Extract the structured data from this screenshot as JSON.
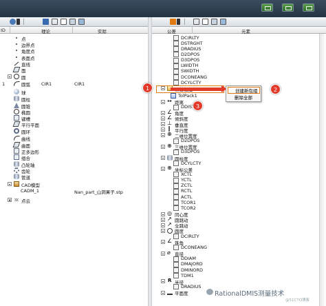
{
  "left_pane": {
    "columns": {
      "id": "ID",
      "nominal": "理论",
      "actual": "实际"
    },
    "features": [
      {
        "label": "点",
        "icon": "point-icon"
      },
      {
        "label": "边界点",
        "icon": "edge-point-icon"
      },
      {
        "label": "角度点",
        "icon": "angle-point-icon"
      },
      {
        "label": "表面点",
        "icon": "surface-point-icon"
      },
      {
        "label": "直线",
        "icon": "line-icon"
      },
      {
        "label": "面",
        "icon": "plane-icon"
      },
      {
        "label": "圆",
        "icon": "circle-icon"
      },
      {
        "label": "圆弧",
        "icon": "arc-icon"
      },
      {
        "label": "球",
        "icon": "sphere-icon"
      },
      {
        "label": "圆柱",
        "icon": "cylinder-icon"
      },
      {
        "label": "圆锥",
        "icon": "cone-icon"
      },
      {
        "label": "椭圆",
        "icon": "ellipse-icon"
      },
      {
        "label": "键槽",
        "icon": "slot-icon"
      },
      {
        "label": "平行平面",
        "icon": "parallel-planes-icon"
      },
      {
        "label": "圆环",
        "icon": "torus-icon"
      },
      {
        "label": "曲线",
        "icon": "curve-icon"
      },
      {
        "label": "曲面",
        "icon": "surface-icon"
      },
      {
        "label": "正多边形",
        "icon": "polygon-icon"
      },
      {
        "label": "组合",
        "icon": "compound-icon"
      },
      {
        "label": "凸轮轴",
        "icon": "camshaft-icon"
      },
      {
        "label": "齿轮",
        "icon": "gear-icon"
      },
      {
        "label": "管道",
        "icon": "pipe-icon"
      },
      {
        "label": "CAD模型",
        "icon": "cad-model-icon"
      },
      {
        "label": "点云",
        "icon": "point-cloud-icon"
      }
    ],
    "circle_item": {
      "id": "1",
      "nominal": "CIR1",
      "actual": "CIR1"
    },
    "cad_item": {
      "name": "CADM_1",
      "file": "Nan_part_山洞果子.stp"
    }
  },
  "right_pane": {
    "columns": {
      "tolerance": "公差",
      "element": "元素"
    },
    "rows": [
      {
        "label": "DCIRLTY",
        "icon": "tolerance-icon"
      },
      {
        "label": "DSTRGHT",
        "icon": "tolerance-icon"
      },
      {
        "label": "DRADIUS",
        "icon": "tolerance-icon"
      },
      {
        "label": "D2DPOS",
        "icon": "tolerance-icon"
      },
      {
        "label": "D3DPOS",
        "icon": "tolerance-icon"
      },
      {
        "label": "LWIDTH",
        "icon": "tolerance-icon"
      },
      {
        "label": "SWIDTH",
        "icon": "tolerance-icon"
      },
      {
        "label": "DCONEANG",
        "icon": "tolerance-icon"
      },
      {
        "label": "DCYLCTY",
        "icon": "tolerance-icon"
      },
      {
        "label": "公差包组",
        "icon": "tolerance-group-icon"
      },
      {
        "label": "TolPack1",
        "icon": "tolerance-pack-icon"
      },
      {
        "label": "距离",
        "icon": "distance-icon"
      },
      {
        "label": "DDIST",
        "icon": "tolerance-icon"
      },
      {
        "label": "角度",
        "icon": "angle-icon"
      },
      {
        "label": "倾斜度",
        "icon": "angularity-icon"
      },
      {
        "label": "垂直度",
        "icon": "perpendicularity-icon"
      },
      {
        "label": "平行度",
        "icon": "parallelism-icon"
      },
      {
        "label": "二维位置度",
        "icon": "position-2d-icon"
      },
      {
        "label": "D2DPOS",
        "icon": "tolerance-icon"
      },
      {
        "label": "三维位置度",
        "icon": "position-3d-icon"
      },
      {
        "label": "D3DPOS",
        "icon": "tolerance-icon"
      },
      {
        "label": "圆柱度",
        "icon": "cylindricity-icon"
      },
      {
        "label": "DCYLCTY",
        "icon": "tolerance-icon"
      },
      {
        "label": "坐标公差",
        "icon": "coordinate-tolerance-icon"
      },
      {
        "label": "XCTL",
        "icon": "tolerance-icon"
      },
      {
        "label": "YCTL",
        "icon": "tolerance-icon"
      },
      {
        "label": "ZCTL",
        "icon": "tolerance-icon"
      },
      {
        "label": "RCTL",
        "icon": "tolerance-icon"
      },
      {
        "label": "ACTL",
        "icon": "tolerance-icon"
      },
      {
        "label": "TCOR1",
        "icon": "tolerance-icon"
      },
      {
        "label": "TCOR2",
        "icon": "tolerance-icon"
      },
      {
        "label": "同心度",
        "icon": "concentricity-icon"
      },
      {
        "label": "圆跳动",
        "icon": "circular-runout-icon"
      },
      {
        "label": "全跳动",
        "icon": "total-runout-icon"
      },
      {
        "label": "圆度",
        "icon": "circularity-icon"
      },
      {
        "label": "DCIRLTY",
        "icon": "tolerance-icon"
      },
      {
        "label": "锥角",
        "icon": "cone-angle-icon"
      },
      {
        "label": "DCONEANG",
        "icon": "tolerance-icon"
      },
      {
        "label": "直径",
        "icon": "diameter-icon"
      },
      {
        "label": "DDIAM",
        "icon": "tolerance-icon"
      },
      {
        "label": "DMAJORD",
        "icon": "tolerance-icon"
      },
      {
        "label": "DMINORD",
        "icon": "tolerance-icon"
      },
      {
        "label": "TDM1",
        "icon": "tolerance-icon"
      },
      {
        "label": "半径",
        "icon": "radius-icon"
      },
      {
        "label": "DRADIUS",
        "icon": "tolerance-icon"
      },
      {
        "label": "平面度",
        "icon": "flatness-icon"
      }
    ]
  },
  "context_menu": {
    "new_group": "创建新包组",
    "delete_all": "删除全部"
  },
  "callouts": {
    "one": "1",
    "two": "2",
    "three": "3"
  },
  "watermark": {
    "text": "RationalDMIS测量技术",
    "sub": "@51CTO博客"
  },
  "colors": {
    "callout": "#e23b2c",
    "highlight": "#e07a10",
    "top_bar": "#2e3e50"
  }
}
